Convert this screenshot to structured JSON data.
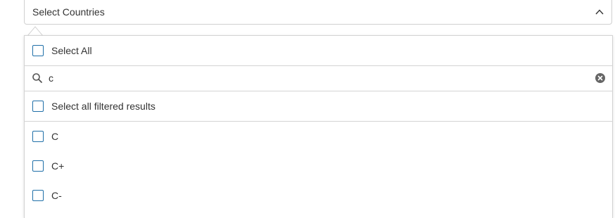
{
  "select": {
    "label": "Select Countries",
    "chevron_icon": "chevron-up-icon"
  },
  "dropdown": {
    "select_all_label": "Select All",
    "search": {
      "value": "c",
      "placeholder": "",
      "search_icon": "search-icon",
      "clear_icon": "clear-icon"
    },
    "select_filtered_label": "Select all filtered results",
    "options": [
      {
        "label": "C",
        "checked": false
      },
      {
        "label": "C+",
        "checked": false
      },
      {
        "label": "C-",
        "checked": false
      }
    ]
  },
  "colors": {
    "checkbox_border": "#1f6fa8",
    "divider": "#d3d3d3",
    "text": "#333333",
    "clear_icon_bg": "#666666"
  }
}
